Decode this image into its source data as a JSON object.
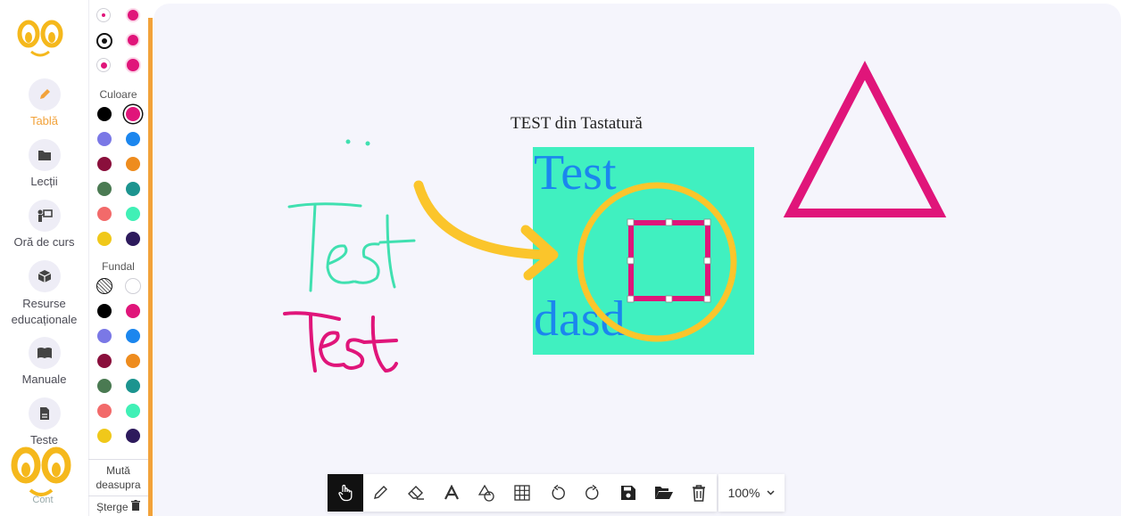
{
  "nav": {
    "items": [
      {
        "label": "Tablă",
        "icon": "pencil-icon",
        "active": true
      },
      {
        "label": "Lecții",
        "icon": "folder-icon",
        "active": false
      },
      {
        "label": "Oră de curs",
        "icon": "teacher-icon",
        "active": false
      },
      {
        "label": "Resurse educaționale",
        "icon": "cube-icon",
        "active": false
      },
      {
        "label": "Manuale",
        "icon": "book-icon",
        "active": false
      },
      {
        "label": "Teste",
        "icon": "document-icon",
        "active": false
      }
    ],
    "cutoff_label": "Cont"
  },
  "palette": {
    "size_label": "",
    "color_title": "Culoare",
    "fill_title": "Fundal",
    "colors": [
      "#000000",
      "#e0157a",
      "#7a78e6",
      "#1b86ee",
      "#8a0f3c",
      "#ee8c1e",
      "#4a7a52",
      "#1c948f",
      "#f26a6a",
      "#40f0b6",
      "#f0c81a",
      "#2d1a5c"
    ],
    "move_up_label": "Mută deasupra",
    "delete_label": "Șterge"
  },
  "canvas": {
    "heading": "TEST din Tastatură",
    "box_text_1": "Test",
    "box_text_2": "dasd",
    "green_handwriting": "Test",
    "pink_handwriting": "Test"
  },
  "toolbar": {
    "tools": [
      "hand-icon",
      "pen-icon",
      "eraser-icon",
      "text-icon",
      "shapes-icon",
      "grid-icon",
      "undo-icon",
      "redo-icon",
      "save-icon",
      "open-folder-icon",
      "trash-icon"
    ],
    "zoom": "100%"
  },
  "colors": {
    "accent": "#f2a23a",
    "canvas_bg": "#f5f5fc",
    "magenta": "#e0157a",
    "mint": "#40f0c0",
    "blue_text": "#1b86ee",
    "yellow_stroke": "#fbc52b"
  }
}
